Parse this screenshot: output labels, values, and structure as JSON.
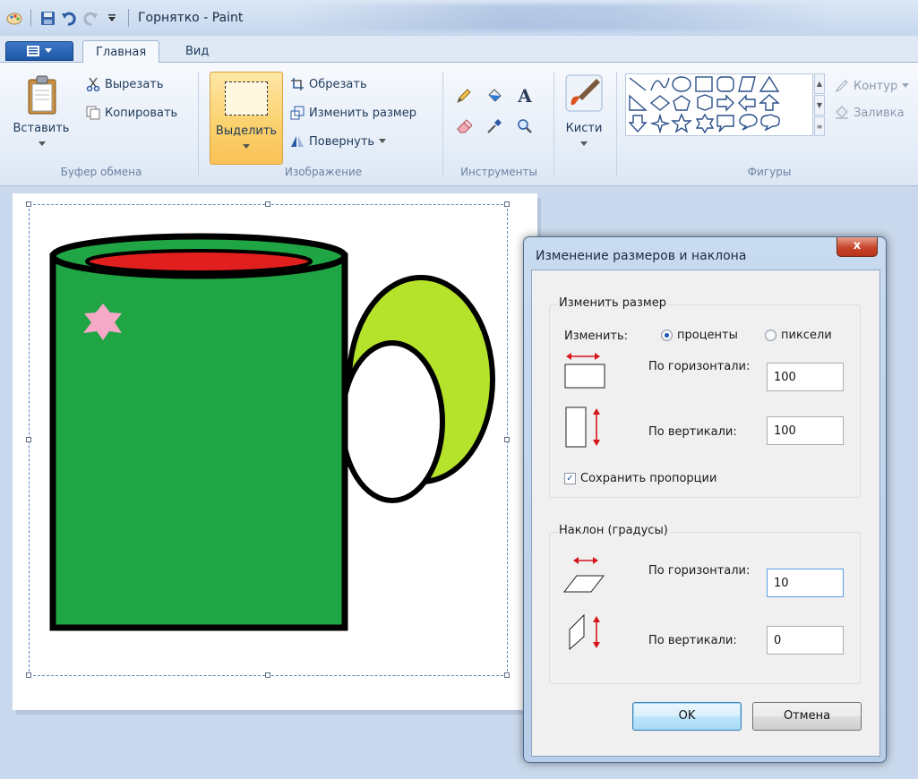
{
  "window": {
    "title": "Горнятко - Paint"
  },
  "tabs": {
    "home": "Главная",
    "view": "Вид"
  },
  "ribbon": {
    "clipboard": {
      "paste": "Вставить",
      "cut": "Вырезать",
      "copy": "Копировать",
      "group": "Буфер обмена"
    },
    "image": {
      "select": "Выделить",
      "crop": "Обрезать",
      "resize": "Изменить размер",
      "rotate": "Повернуть",
      "group": "Изображение"
    },
    "tools": {
      "group": "Инструменты",
      "text_glyph": "A"
    },
    "brushes": {
      "label": "Кисти"
    },
    "shapes": {
      "group": "Фигуры",
      "outline": "Контур",
      "fill": "Заливка"
    }
  },
  "dialog": {
    "title": "Изменение размеров и наклона",
    "close": "x",
    "resize_section": "Изменить размер",
    "change_by": "Изменить:",
    "option_percent": "проценты",
    "option_pixels": "пиксели",
    "selected_option": "percent",
    "horizontal_label": "По горизонтали:",
    "vertical_label": "По вертикали:",
    "resize_horizontal": "100",
    "resize_vertical": "100",
    "keep_ratio": "Сохранить пропорции",
    "keep_ratio_checked": true,
    "skew_section": "Наклон (градусы)",
    "skew_horizontal_label": "По горизонтали:",
    "skew_vertical_label": "По вертикали:",
    "skew_horizontal": "10",
    "skew_vertical": "0",
    "ok": "OK",
    "cancel": "Отмена"
  },
  "colors": {
    "mug_body": "#1fa544",
    "mug_handle": "#b5e22a",
    "coffee": "#e21f1f",
    "star": "#f6a8c7",
    "accent": "#1d57a8"
  }
}
